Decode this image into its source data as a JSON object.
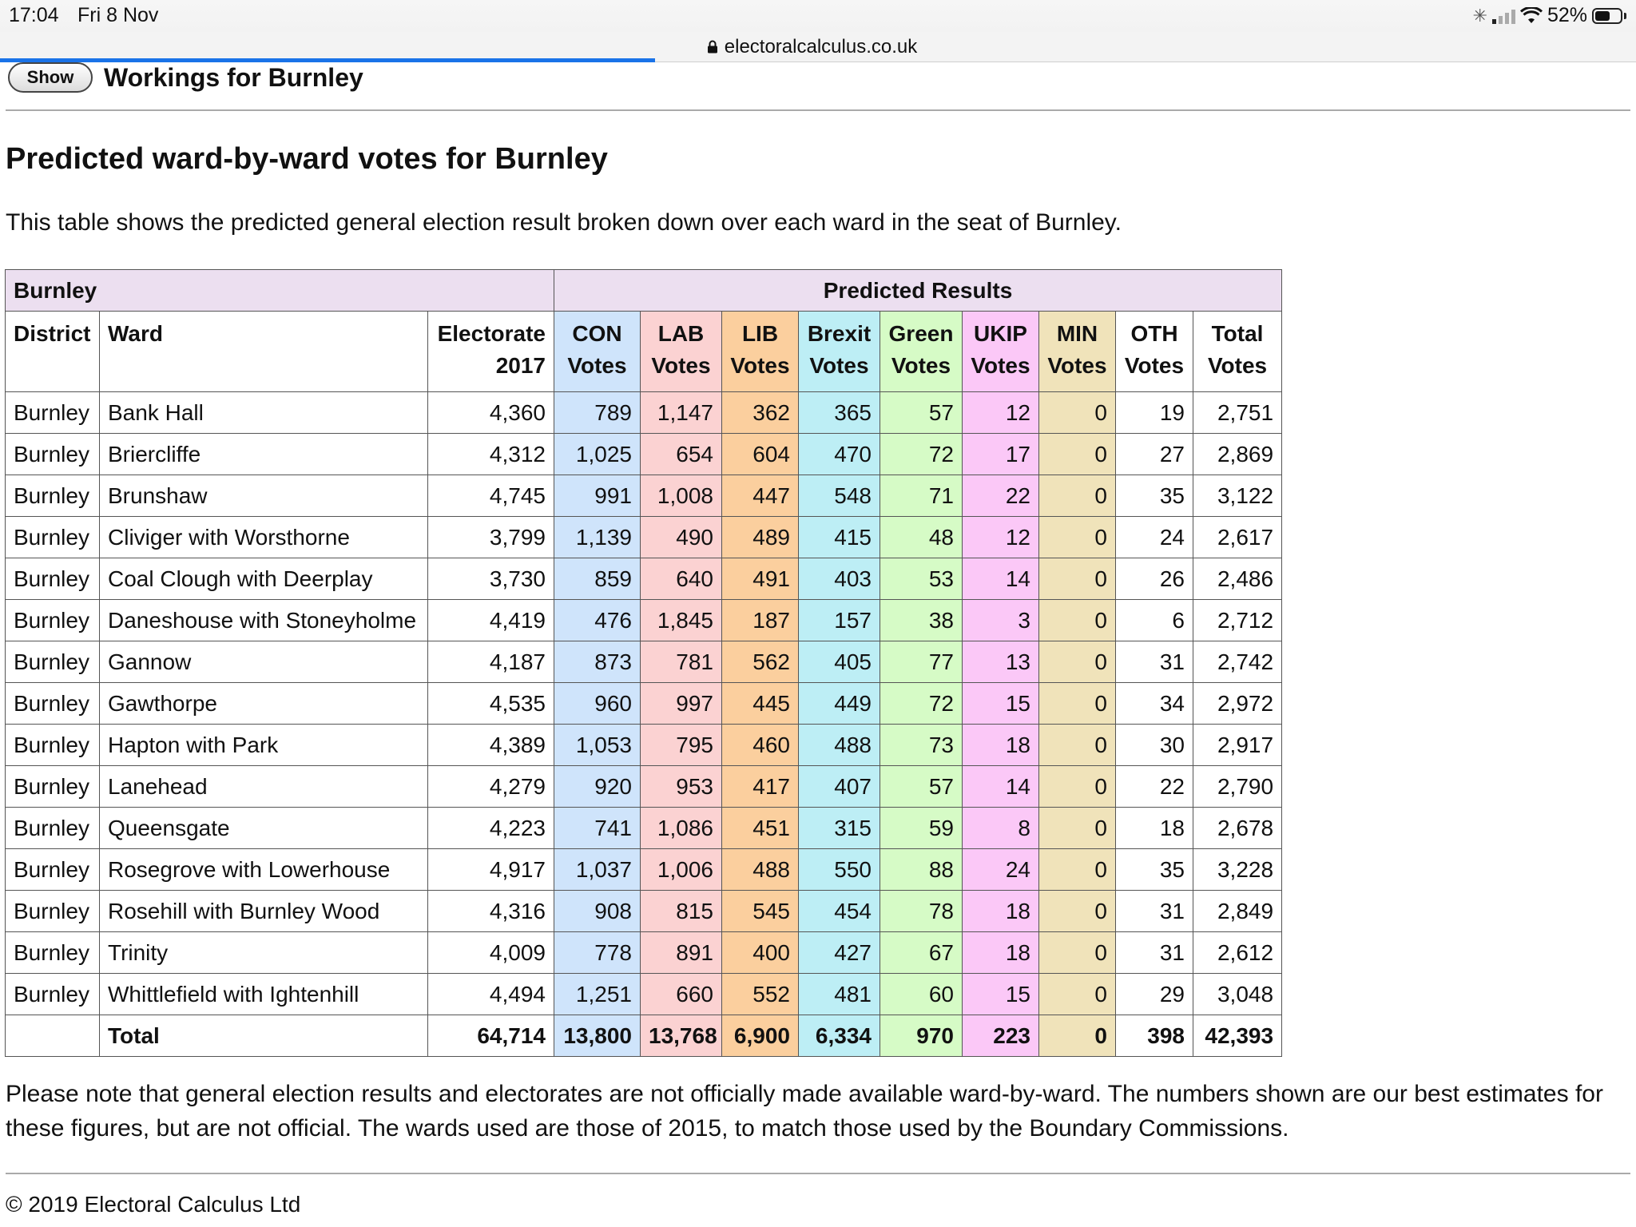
{
  "status_bar": {
    "time": "17:04",
    "date": "Fri 8 Nov",
    "battery": "52%"
  },
  "browser": {
    "url": "electoralcalculus.co.uk"
  },
  "workings": {
    "show_label": "Show",
    "title": "Workings for Burnley"
  },
  "heading": "Predicted ward-by-ward votes for Burnley",
  "intro": "This table shows the predicted general election result broken down over each ward in the seat of Burnley.",
  "table": {
    "group_left": "Burnley",
    "group_right": "Predicted Results",
    "headers": [
      [
        "District",
        ""
      ],
      [
        "Ward",
        ""
      ],
      [
        "Electorate",
        "2017"
      ],
      [
        "CON",
        "Votes"
      ],
      [
        "LAB",
        "Votes"
      ],
      [
        "LIB",
        "Votes"
      ],
      [
        "Brexit",
        "Votes"
      ],
      [
        "Green",
        "Votes"
      ],
      [
        "UKIP",
        "Votes"
      ],
      [
        "MIN",
        "Votes"
      ],
      [
        "OTH",
        "Votes"
      ],
      [
        "Total",
        "Votes"
      ]
    ],
    "rows": [
      [
        "Burnley",
        "Bank Hall",
        "4,360",
        "789",
        "1,147",
        "362",
        "365",
        "57",
        "12",
        "0",
        "19",
        "2,751"
      ],
      [
        "Burnley",
        "Briercliffe",
        "4,312",
        "1,025",
        "654",
        "604",
        "470",
        "72",
        "17",
        "0",
        "27",
        "2,869"
      ],
      [
        "Burnley",
        "Brunshaw",
        "4,745",
        "991",
        "1,008",
        "447",
        "548",
        "71",
        "22",
        "0",
        "35",
        "3,122"
      ],
      [
        "Burnley",
        "Cliviger with Worsthorne",
        "3,799",
        "1,139",
        "490",
        "489",
        "415",
        "48",
        "12",
        "0",
        "24",
        "2,617"
      ],
      [
        "Burnley",
        "Coal Clough with Deerplay",
        "3,730",
        "859",
        "640",
        "491",
        "403",
        "53",
        "14",
        "0",
        "26",
        "2,486"
      ],
      [
        "Burnley",
        "Daneshouse with Stoneyholme",
        "4,419",
        "476",
        "1,845",
        "187",
        "157",
        "38",
        "3",
        "0",
        "6",
        "2,712"
      ],
      [
        "Burnley",
        "Gannow",
        "4,187",
        "873",
        "781",
        "562",
        "405",
        "77",
        "13",
        "0",
        "31",
        "2,742"
      ],
      [
        "Burnley",
        "Gawthorpe",
        "4,535",
        "960",
        "997",
        "445",
        "449",
        "72",
        "15",
        "0",
        "34",
        "2,972"
      ],
      [
        "Burnley",
        "Hapton with Park",
        "4,389",
        "1,053",
        "795",
        "460",
        "488",
        "73",
        "18",
        "0",
        "30",
        "2,917"
      ],
      [
        "Burnley",
        "Lanehead",
        "4,279",
        "920",
        "953",
        "417",
        "407",
        "57",
        "14",
        "0",
        "22",
        "2,790"
      ],
      [
        "Burnley",
        "Queensgate",
        "4,223",
        "741",
        "1,086",
        "451",
        "315",
        "59",
        "8",
        "0",
        "18",
        "2,678"
      ],
      [
        "Burnley",
        "Rosegrove with Lowerhouse",
        "4,917",
        "1,037",
        "1,006",
        "488",
        "550",
        "88",
        "24",
        "0",
        "35",
        "3,228"
      ],
      [
        "Burnley",
        "Rosehill with Burnley Wood",
        "4,316",
        "908",
        "815",
        "545",
        "454",
        "78",
        "18",
        "0",
        "31",
        "2,849"
      ],
      [
        "Burnley",
        "Trinity",
        "4,009",
        "778",
        "891",
        "400",
        "427",
        "67",
        "18",
        "0",
        "31",
        "2,612"
      ],
      [
        "Burnley",
        "Whittlefield with Ightenhill",
        "4,494",
        "1,251",
        "660",
        "552",
        "481",
        "60",
        "15",
        "0",
        "29",
        "3,048"
      ]
    ],
    "total_row": [
      "",
      "Total",
      "64,714",
      "13,800",
      "13,768",
      "6,900",
      "6,334",
      "970",
      "223",
      "0",
      "398",
      "42,393"
    ]
  },
  "note": "Please note that general election results and electorates are not officially made available ward-by-ward. The numbers shown are our best estimates for these figures, but are not official. The wards used are those of 2015, to match those used by the Boundary Commissions.",
  "footer": "© 2019 Electoral Calculus Ltd",
  "colors": {
    "header_band": "#ecdff0",
    "con": "#cfe4fb",
    "lab": "#fbd2d2",
    "lib": "#fbcf9e",
    "brexit": "#bdeef5",
    "green": "#d6fbc6",
    "ukip": "#fbc8f7",
    "min": "#f0e3ba",
    "loading_bar": "#1a73e8"
  },
  "icons": [
    "lock-icon",
    "activity-spinner-icon",
    "cell-signal-icon",
    "wifi-icon",
    "battery-icon"
  ]
}
